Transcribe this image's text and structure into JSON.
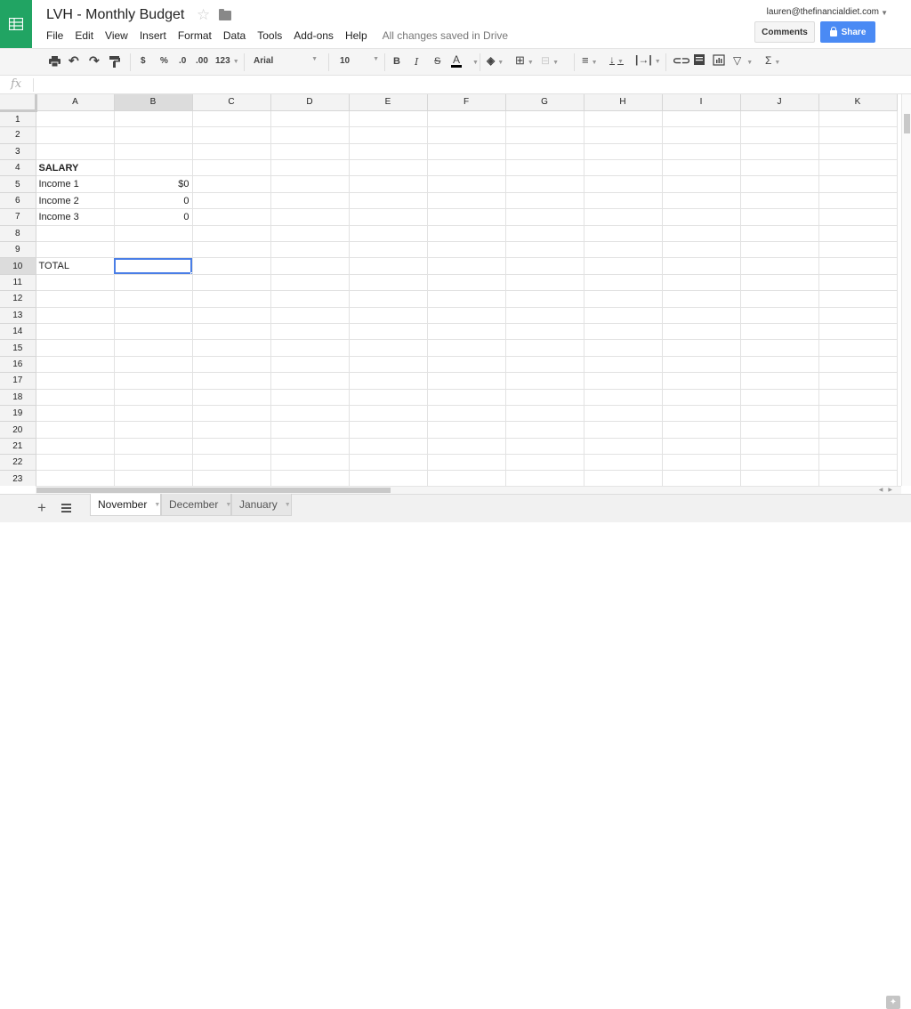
{
  "header": {
    "title": "LVH - Monthly Budget",
    "menu": [
      "File",
      "Edit",
      "View",
      "Insert",
      "Format",
      "Data",
      "Tools",
      "Add-ons",
      "Help"
    ],
    "save_status": "All changes saved in Drive",
    "user_email": "lauren@thefinancialdiet.com",
    "comments_label": "Comments",
    "share_label": "Share",
    "brand_color": "#21a463",
    "share_color": "#4a8af4"
  },
  "toolbar": {
    "currency": "$",
    "percent": "%",
    "dec_decrease": ".0",
    "dec_increase": ".00",
    "more_formats": "123",
    "font": "Arial",
    "font_size": "10",
    "bold": "B",
    "italic": "I",
    "strike": "S",
    "text_color": "A",
    "sum": "Σ"
  },
  "formula_bar": {
    "label": "fx",
    "value": ""
  },
  "grid": {
    "columns": [
      "A",
      "B",
      "C",
      "D",
      "E",
      "F",
      "G",
      "H",
      "I",
      "J",
      "K"
    ],
    "selected_column": "B",
    "selected_row": 10,
    "rows": [
      {
        "n": "1",
        "a": "",
        "b": ""
      },
      {
        "n": "2",
        "a": "",
        "b": ""
      },
      {
        "n": "3",
        "a": "",
        "b": ""
      },
      {
        "n": "4",
        "a": "SALARY",
        "b": ""
      },
      {
        "n": "5",
        "a": "Income 1",
        "b": "$0"
      },
      {
        "n": "6",
        "a": "Income 2",
        "b": "0"
      },
      {
        "n": "7",
        "a": "Income 3",
        "b": "0"
      },
      {
        "n": "8",
        "a": "",
        "b": ""
      },
      {
        "n": "9",
        "a": "",
        "b": ""
      },
      {
        "n": "10",
        "a": "TOTAL",
        "b": ""
      },
      {
        "n": "11",
        "a": "",
        "b": ""
      },
      {
        "n": "12",
        "a": "",
        "b": ""
      },
      {
        "n": "13",
        "a": "",
        "b": ""
      },
      {
        "n": "14",
        "a": "",
        "b": ""
      },
      {
        "n": "15",
        "a": "",
        "b": ""
      },
      {
        "n": "16",
        "a": "",
        "b": ""
      },
      {
        "n": "17",
        "a": "",
        "b": ""
      },
      {
        "n": "18",
        "a": "",
        "b": ""
      },
      {
        "n": "19",
        "a": "",
        "b": ""
      },
      {
        "n": "20",
        "a": "",
        "b": ""
      },
      {
        "n": "21",
        "a": "",
        "b": ""
      },
      {
        "n": "22",
        "a": "",
        "b": ""
      },
      {
        "n": "23",
        "a": "",
        "b": ""
      }
    ]
  },
  "sheets": {
    "tabs": [
      "November",
      "December",
      "January"
    ],
    "active": "November"
  }
}
